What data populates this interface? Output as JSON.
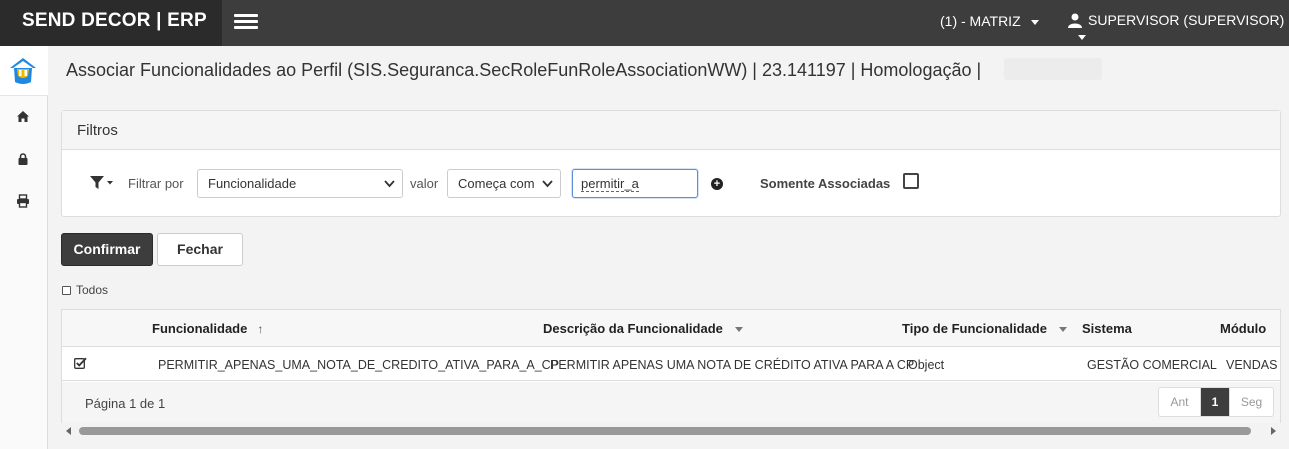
{
  "header": {
    "brand": "SEND DECOR | ERP",
    "company": "(1) - MATRIZ",
    "user": "SUPERVISOR (SUPERVISOR)"
  },
  "sidebar": {
    "icons": [
      "home-icon",
      "lock-icon",
      "print-icon"
    ]
  },
  "page": {
    "title": "Associar Funcionalidades ao Perfil (SIS.Seguranca.SecRoleFunRoleAssociationWW) | 23.141197 | Homologação |"
  },
  "filters": {
    "title": "Filtros",
    "filter_by_label": "Filtrar por",
    "filter_by_value": "Funcionalidade",
    "value_label": "valor",
    "operator_value": "Começa com",
    "search_value": "permitir_a",
    "only_associated_label": "Somente Associadas"
  },
  "actions": {
    "confirm_label": "Confirmar",
    "close_label": "Fechar",
    "all_label": "Todos"
  },
  "grid": {
    "columns": [
      "Funcionalidade",
      "Descrição da Funcionalidade",
      "Tipo de Funcionalidade",
      "Sistema",
      "Módulo"
    ],
    "rows": [
      {
        "checked": true,
        "funcionalidade": "PERMITIR_APENAS_UMA_NOTA_DE_CREDITO_ATIVA_PARA_A_CP",
        "descricao": "PERMITIR APENAS UMA NOTA DE CRÉDITO ATIVA PARA A CP",
        "tipo": "Object",
        "sistema": "GESTÃO COMERCIAL",
        "modulo": "VENDAS"
      }
    ],
    "page_info": "Página 1 de 1",
    "pager": {
      "prev": "Ant",
      "current": "1",
      "next": "Seg"
    }
  },
  "colors": {
    "topbar": "#3d3d3d",
    "brand_bg": "#2b2b2b",
    "primary_button": "#3d3d3d",
    "logo_blue": "#1e88e5",
    "logo_yellow": "#f5b800"
  }
}
